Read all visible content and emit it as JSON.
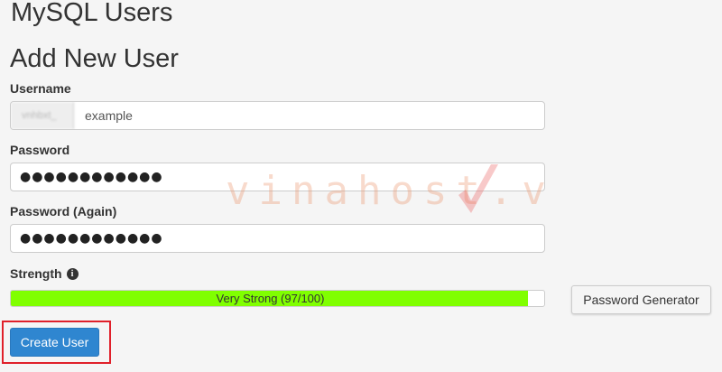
{
  "page": {
    "section_title": "MySQL Users",
    "subsection_title": "Add New User"
  },
  "form": {
    "username": {
      "label": "Username",
      "prefix": "vnhbxt_",
      "value": "example"
    },
    "password": {
      "label": "Password",
      "masked_value": "●●●●●●●●●●●●"
    },
    "password_again": {
      "label": "Password (Again)",
      "masked_value": "●●●●●●●●●●●●"
    },
    "strength": {
      "label": "Strength",
      "bar_text": "Very Strong (97/100)",
      "score": 97,
      "max": 100,
      "bar_color": "#80ff00"
    },
    "password_generator_label": "Password Generator",
    "create_user_label": "Create User"
  },
  "watermark": {
    "text": "vinahost.v",
    "color": "#eb966e"
  },
  "colors": {
    "primary_button": "#2f86d0",
    "highlight_border": "#e0202a"
  }
}
